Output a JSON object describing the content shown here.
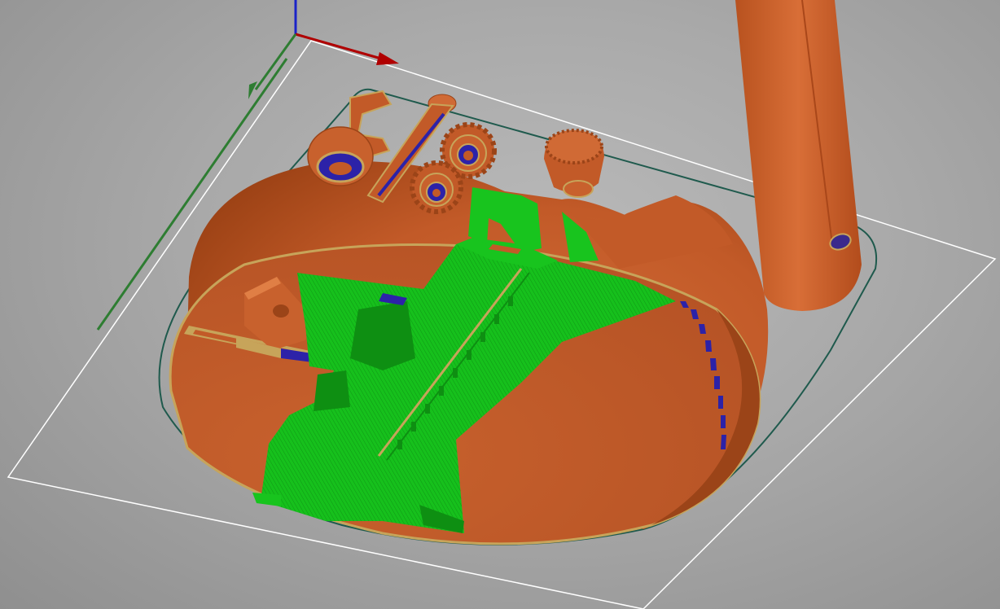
{
  "viewport": {
    "background": "#a9a9a9",
    "axis_colors": {
      "x": "#b00000",
      "y": "#2e7d32",
      "z": "#1a23c8"
    }
  },
  "materials": {
    "print_orange": "#c9622f",
    "print_orange_light": "#e07f45",
    "print_orange_dark": "#9b4418",
    "support_green": "#18c41e",
    "support_green_dark": "#0e8f12",
    "bridge_blue": "#2c22a8",
    "perimeter_tan": "#c7a45a",
    "skirt_teal": "#1f5a4d",
    "bed_outline": "#ffffff"
  },
  "objects": [
    "print-bed-outline",
    "skirt-outline",
    "hemisphere-shell",
    "support-structure",
    "gear-left",
    "gear-right",
    "knurled-knob",
    "slot-link-part",
    "bearing-clip-part",
    "tall-cylinder-tower",
    "latch-part"
  ]
}
